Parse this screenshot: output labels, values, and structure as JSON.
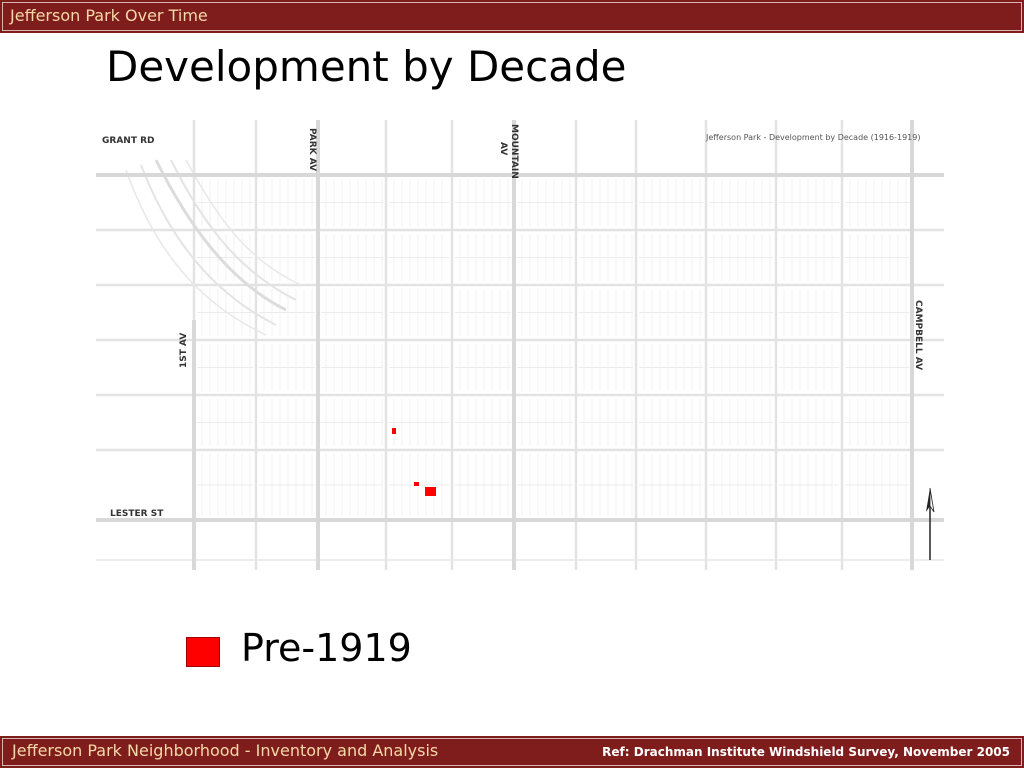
{
  "header": {
    "section_title": "Jefferson Park Over Time"
  },
  "slide": {
    "title": "Development by Decade"
  },
  "map": {
    "title": "Jefferson Park - Development by Decade (1916-1919)",
    "streets": {
      "grant": "GRANT RD",
      "park": "PARK AV",
      "mountain_1": "MOUNTAIN",
      "mountain_2": "AV",
      "first": "1ST AV",
      "campbell": "CAMPBELL AV",
      "lester": "LESTER ST"
    },
    "north_arrow": "north-arrow-icon",
    "highlight_color": "#ff0000"
  },
  "legend": {
    "label": "Pre-1919",
    "color": "#ff0000"
  },
  "footer": {
    "left": "Jefferson Park Neighborhood - Inventory and Analysis",
    "right": "Ref: Drachman Institute Windshield Survey, November 2005"
  },
  "colors": {
    "brand": "#7f1d1d",
    "header_text": "#f5d9a8"
  }
}
